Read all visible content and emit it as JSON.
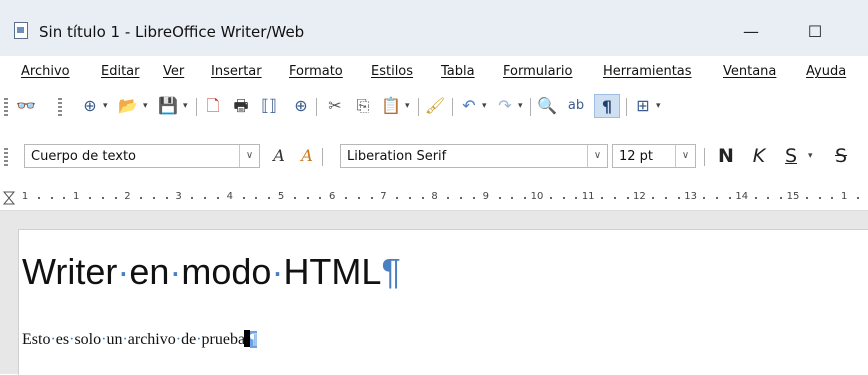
{
  "window": {
    "title": "Sin título 1 - LibreOffice Writer/Web",
    "minimize_glyph": "—",
    "maximize_glyph": "☐"
  },
  "menu": [
    {
      "label": "Archivo"
    },
    {
      "label": "Editar"
    },
    {
      "label": "Ver"
    },
    {
      "label": "Insertar"
    },
    {
      "label": "Formato"
    },
    {
      "label": "Estilos"
    },
    {
      "label": "Tabla"
    },
    {
      "label": "Formulario"
    },
    {
      "label": "Herramientas"
    },
    {
      "label": "Ventana"
    },
    {
      "label": "Ayuda"
    }
  ],
  "toolbar_standard": {
    "icons": [
      "binoculars-icon",
      "globe-icon",
      "folder-open-icon",
      "save-icon",
      "export-pdf-icon",
      "print-icon",
      "html-source-icon",
      "web-view-icon",
      "cut-icon",
      "copy-icon",
      "paste-icon",
      "clone-formatting-icon",
      "undo-icon",
      "redo-icon",
      "spelling-icon",
      "autocorrect-icon",
      "formatting-marks-icon",
      "table-icon"
    ],
    "glyphs": {
      "binoculars": "👓",
      "globe": "⊕",
      "folder": "📂",
      "save": "💾",
      "pdf": "🗋",
      "print": "🖶",
      "source": "⟦⟧",
      "web": "⊕",
      "cut": "✂",
      "copy": "⎘",
      "paste": "📋",
      "brush": "🖌",
      "undo": "↶",
      "redo": "↷",
      "spell": "🔍",
      "abc": "ab",
      "pilcrow": "¶",
      "table": "⊞",
      "dropdown": "▾"
    }
  },
  "toolbar_formatting": {
    "paragraph_style": "Cuerpo de texto",
    "font_name": "Liberation Serif",
    "font_size": "12 pt",
    "bold_label": "N",
    "italic_label": "K",
    "underline_label": "S",
    "strike_label": "S",
    "update_style_glyph": "A",
    "new_style_glyph": "A",
    "dropdown_glyph": "∨"
  },
  "ruler": {
    "numbers": [
      "1",
      "1",
      "2",
      "3",
      "4",
      "5",
      "6",
      "7",
      "8",
      "9",
      "10",
      "11",
      "12",
      "13",
      "14",
      "15",
      "1"
    ]
  },
  "document": {
    "heading_words": [
      "Writer",
      "en",
      "modo",
      "HTML"
    ],
    "paragraph_words": [
      "Esto",
      "es",
      "solo",
      "un",
      "archivo",
      "de",
      "prueba"
    ],
    "space_marker": "·",
    "paragraph_mark": "¶"
  },
  "colors": {
    "accent": "#4a7fc1",
    "titlebar": "#e9eef4",
    "workspace": "#e7e7e7"
  }
}
